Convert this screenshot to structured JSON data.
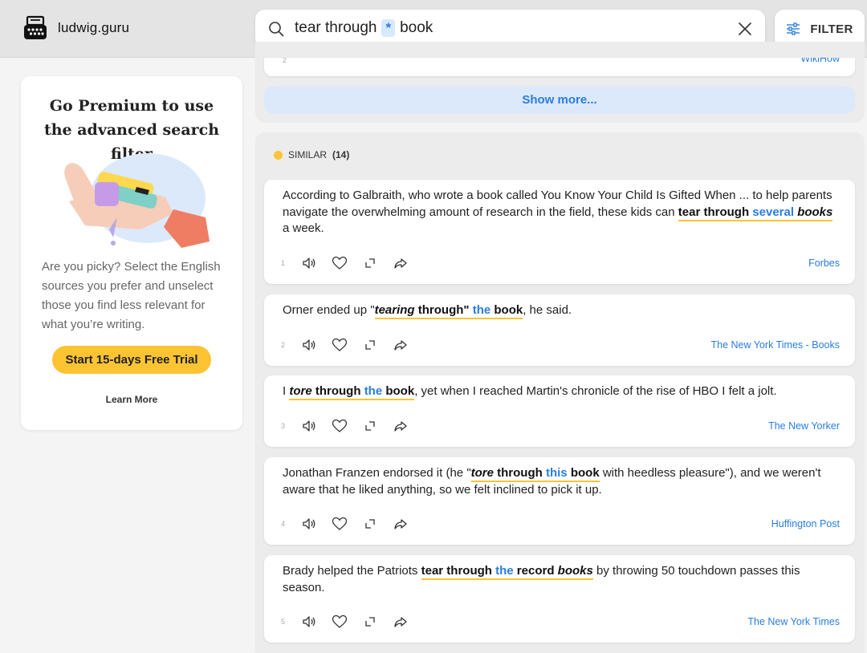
{
  "header": {
    "logo_text": "ludwig.guru",
    "search": {
      "before": "tear through",
      "wildcard": "*",
      "after": "book"
    },
    "filter_label": "FILTER"
  },
  "sidebar": {
    "title": "Go Premium to use the advanced search filter",
    "description": "Are you picky? Select the English sources you prefer and unselect those you find less relevant for what you’re writing.",
    "trial_button": "Start 15-days Free Trial",
    "learn_more": "Learn More"
  },
  "previous": {
    "number": "2",
    "source": "WikiHow",
    "show_more": "Show more..."
  },
  "similar": {
    "label": "SIMILAR",
    "count": "(14)"
  },
  "results": [
    {
      "number": "1",
      "source": "Forbes",
      "parts": [
        {
          "t": "According to Galbraith, who wrote a book called You Know Your Child Is Gifted When ... to help parents navigate the overwhelming amount of research in the field, these kids can "
        },
        {
          "t": "tear through",
          "s": "b",
          "hl": true
        },
        {
          "t": " ",
          "hl": true
        },
        {
          "t": "several",
          "s": "blue",
          "hl": true
        },
        {
          "t": " ",
          "hl": true
        },
        {
          "t": "books",
          "s": "bi",
          "hl": true
        },
        {
          "t": " a week."
        }
      ]
    },
    {
      "number": "2",
      "source": "The New York Times - Books",
      "parts": [
        {
          "t": "Orner ended up \""
        },
        {
          "t": "tearing",
          "s": "bi",
          "hl": true
        },
        {
          "t": " through\"",
          "s": "b",
          "hl": true
        },
        {
          "t": " ",
          "hl": true
        },
        {
          "t": "the",
          "s": "blue",
          "hl": true
        },
        {
          "t": " ",
          "hl": true
        },
        {
          "t": "book",
          "s": "b",
          "hl": true
        },
        {
          "t": ", he said."
        }
      ]
    },
    {
      "number": "3",
      "source": "The New Yorker",
      "parts": [
        {
          "t": "I "
        },
        {
          "t": "tore",
          "s": "bi",
          "hl": true
        },
        {
          "t": " through",
          "s": "b",
          "hl": true
        },
        {
          "t": " ",
          "hl": true
        },
        {
          "t": "the",
          "s": "blue",
          "hl": true
        },
        {
          "t": " ",
          "hl": true
        },
        {
          "t": "book",
          "s": "b",
          "hl": true
        },
        {
          "t": ", yet when I reached Martin's chronicle of the rise of HBO I felt a jolt."
        }
      ]
    },
    {
      "number": "4",
      "source": "Huffington Post",
      "parts": [
        {
          "t": "Jonathan Franzen endorsed it (he \""
        },
        {
          "t": "tore",
          "s": "bi",
          "hl": true
        },
        {
          "t": " through",
          "s": "b",
          "hl": true
        },
        {
          "t": " ",
          "hl": true
        },
        {
          "t": "this",
          "s": "blue",
          "hl": true
        },
        {
          "t": " ",
          "hl": true
        },
        {
          "t": "book",
          "s": "b",
          "hl": true
        },
        {
          "t": " with heedless pleasure\"), and we weren't aware that he liked anything, so we felt inclined to pick it up."
        }
      ]
    },
    {
      "number": "5",
      "source": "The New York Times",
      "parts": [
        {
          "t": "Brady helped the Patriots "
        },
        {
          "t": "tear through",
          "s": "b",
          "hl": true
        },
        {
          "t": " ",
          "hl": true
        },
        {
          "t": "the",
          "s": "blue",
          "hl": true
        },
        {
          "t": " ",
          "hl": true
        },
        {
          "t": "record",
          "s": "b",
          "hl": true
        },
        {
          "t": " ",
          "hl": true
        },
        {
          "t": "books",
          "s": "bi",
          "hl": true
        },
        {
          "t": " by throwing 50 touchdown passes this season."
        }
      ]
    }
  ],
  "colors": {
    "accent_yellow": "#fcc433",
    "link_blue": "#2a7de1",
    "show_more_bg": "#dbe9fb"
  }
}
